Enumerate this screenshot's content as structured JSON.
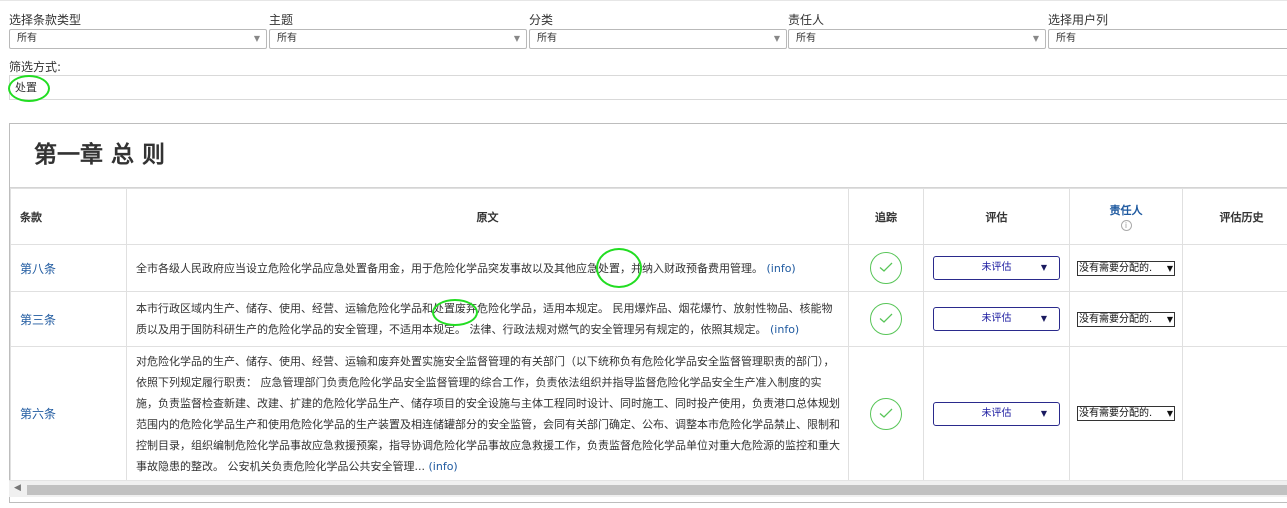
{
  "filters": [
    {
      "label": "选择条款类型",
      "value": "所有"
    },
    {
      "label": "主题",
      "value": "所有"
    },
    {
      "label": "分类",
      "value": "所有"
    },
    {
      "label": "责任人",
      "value": "所有"
    },
    {
      "label": "选择用户列",
      "value": "所有"
    }
  ],
  "filter_method": {
    "label": "筛选方式:",
    "value": "处置"
  },
  "chapter_title": "第一章 总 则",
  "columns": {
    "clause": "条款",
    "original": "原文",
    "track": "追踪",
    "evaluate": "评估",
    "responsible": "责任人",
    "history": "评估历史"
  },
  "rows": [
    {
      "clause": "第八条",
      "text": "全市各级人民政府应当设立危险化学品应急处置备用金，用于危险化学品突发事故以及其他应急处置，并纳入财政预备费用管理。",
      "info": "(info)",
      "eval": "未评估",
      "responsible": "没有需要分配的."
    },
    {
      "clause": "第三条",
      "text": "本市行政区域内生产、储存、使用、经营、运输危险化学品和处置废弃危险化学品，适用本规定。 民用爆炸品、烟花爆竹、放射性物品、核能物质以及用于国防科研生产的危险化学品的安全管理，不适用本规定。 法律、行政法规对燃气的安全管理另有规定的，依照其规定。",
      "info": "(info)",
      "eval": "未评估",
      "responsible": "没有需要分配的."
    },
    {
      "clause": "第六条",
      "text": "对危险化学品的生产、储存、使用、经营、运输和废弃处置实施安全监督管理的有关部门（以下统称负有危险化学品安全监督管理职责的部门），依照下列规定履行职责： 应急管理部门负责危险化学品安全监督管理的综合工作，负责依法组织并指导监督危险化学品安全生产准入制度的实施，负责监督检查新建、改建、扩建的危险化学品生产、储存项目的安全设施与主体工程同时设计、同时施工、同时投产使用，负责港口总体规划范围内的危险化学品生产和使用危险化学品的生产装置及相连储罐部分的安全监管，会同有关部门确定、公布、调整本市危险化学品禁止、限制和控制目录，组织编制危险化学品事故应急救援预案，指导协调危险化学品事故应急救援工作，负责监督危险化学品单位对重大危险源的监控和重大事故隐患的整改。 公安机关负责危险化学品公共安全管理...",
      "info": "(info)",
      "eval": "未评估",
      "responsible": "没有需要分配的."
    }
  ]
}
